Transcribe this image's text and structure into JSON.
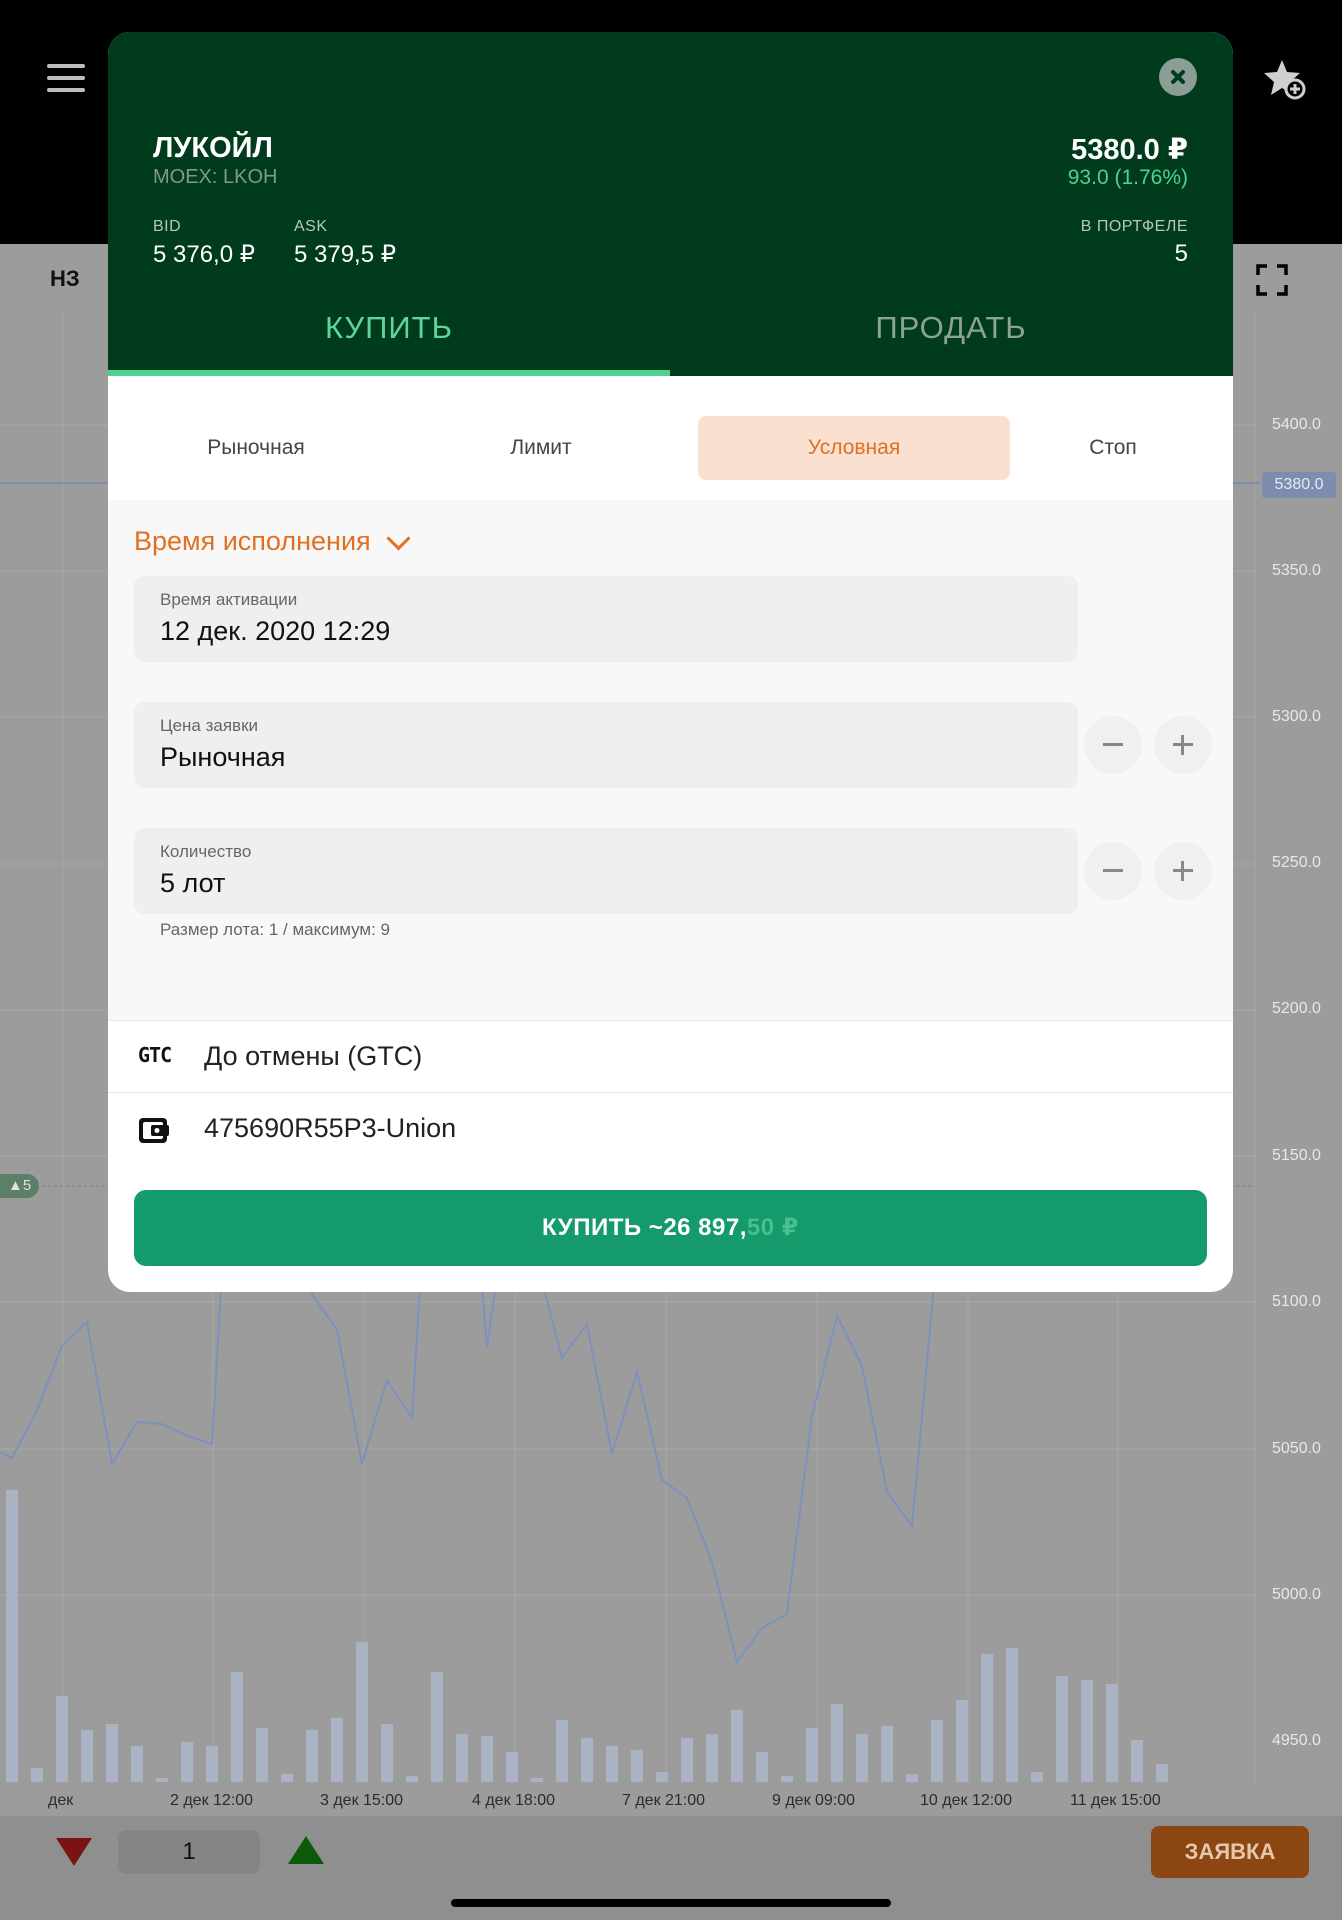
{
  "chart": {
    "label": "НЗ",
    "y_ticks": [
      "5400.0",
      "5380.0",
      "5350.0",
      "5300.0",
      "5250.0",
      "5200.0",
      "5150.0",
      "5100.0",
      "5050.0",
      "5000.0",
      "4950.0"
    ],
    "x_ticks": [
      "дек",
      "2 дек 12:00",
      "3 дек 15:00",
      "4 дек 18:00",
      "7 дек 21:00",
      "9 дек 09:00",
      "10 дек 12:00",
      "11 дек 15:00"
    ],
    "position_marker": "▲5"
  },
  "bottom_bar": {
    "quantity": "1",
    "order_label": "ЗАЯВКА"
  },
  "instrument": {
    "name": "ЛУКОЙЛ",
    "exchange": "MOEX: LKOH",
    "price": "5380.0 ₽",
    "change": "93.0 (1.76%)",
    "bid_label": "BID",
    "bid_value": "5 376,0 ₽",
    "ask_label": "ASK",
    "ask_value": "5 379,5 ₽",
    "portfolio_label": "В ПОРТФЕЛЕ",
    "portfolio_value": "5"
  },
  "tabs": {
    "buy": "КУПИТЬ",
    "sell": "ПРОДАТЬ"
  },
  "order_types": [
    "Рыночная",
    "Лимит",
    "Условная",
    "Стоп"
  ],
  "form": {
    "section_title": "Время исполнения",
    "activation_label": "Время активации",
    "activation_value": "12 дек. 2020 12:29",
    "price_label": "Цена заявки",
    "price_value": "Рыночная",
    "qty_label": "Количество",
    "qty_value": "5 лот",
    "hint": "Размер лота: 1 / максимум: 9"
  },
  "options": {
    "gtc_icon": "GTC",
    "duration": "До отмены (GTC)",
    "account": "475690R55P3-Union"
  },
  "submit": {
    "main": "КУПИТЬ ~26 897,",
    "fade": "50 ₽"
  }
}
